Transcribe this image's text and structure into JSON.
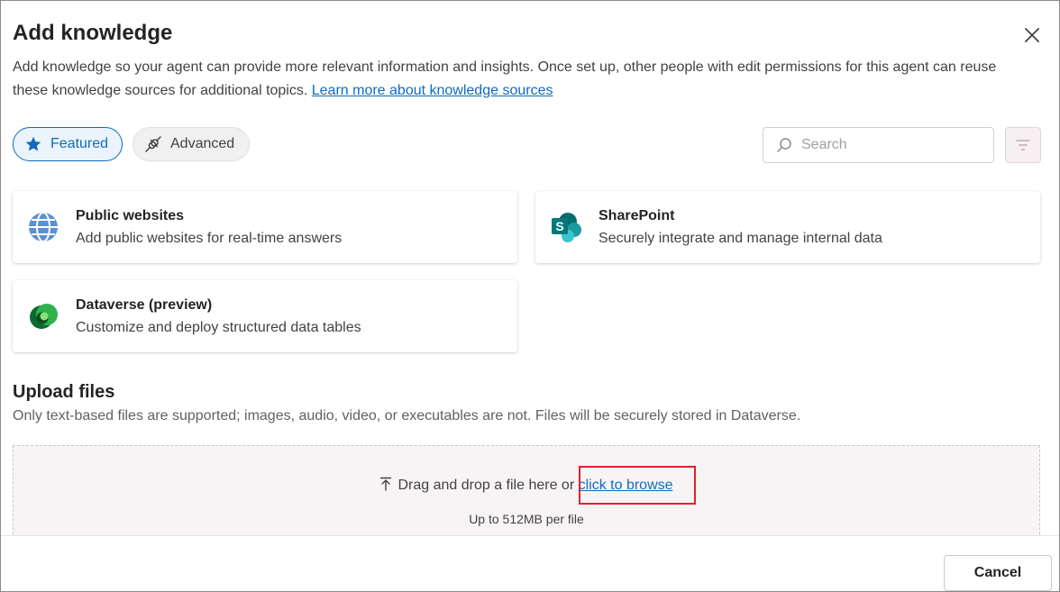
{
  "dialog": {
    "title": "Add knowledge",
    "description_text": "Add knowledge so your agent can provide more relevant information and insights. Once set up, other people with edit permissions for this agent can reuse these knowledge sources for additional topics. ",
    "learn_more_link": "Learn more about knowledge sources"
  },
  "filters": {
    "featured_label": "Featured",
    "advanced_label": "Advanced",
    "search_placeholder": "Search"
  },
  "sources": [
    {
      "title": "Public websites",
      "description": "Add public websites for real-time answers",
      "icon": "globe-icon"
    },
    {
      "title": "SharePoint",
      "description": "Securely integrate and manage internal data",
      "icon": "sharepoint-icon"
    },
    {
      "title": "Dataverse (preview)",
      "description": "Customize and deploy structured data tables",
      "icon": "dataverse-icon"
    }
  ],
  "upload": {
    "heading": "Upload files",
    "note": "Only text-based files are supported; images, audio, video, or executables are not. Files will be securely stored in Dataverse.",
    "drop_text": "Drag and drop a file here or ",
    "browse_link": "click to browse",
    "limit_text": "Up to 512MB per file"
  },
  "footer": {
    "cancel_label": "Cancel"
  },
  "colors": {
    "accent": "#0f6cbd",
    "highlight_box": "#e3202e",
    "dropzone_bg": "#f8f4f6"
  }
}
